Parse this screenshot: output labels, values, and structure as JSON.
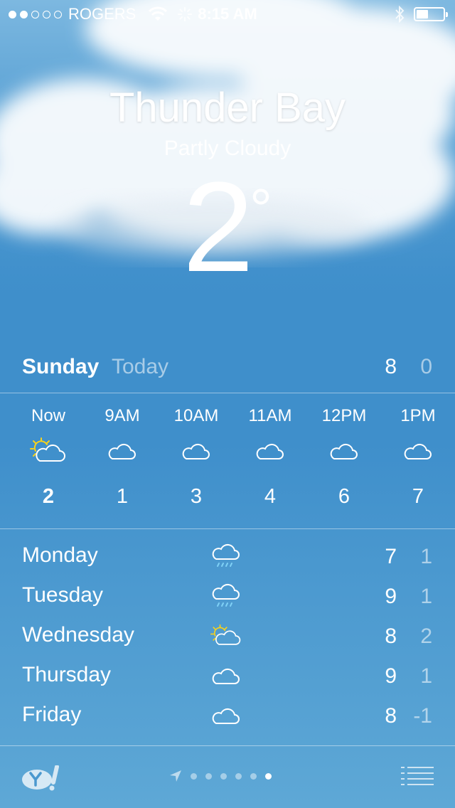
{
  "status_bar": {
    "carrier": "ROGERS",
    "time": "8:15 AM",
    "signal_bars": 2,
    "battery_level": 0.4
  },
  "location": {
    "city": "Thunder Bay",
    "condition": "Partly Cloudy",
    "temperature": "2",
    "degree_symbol": "°"
  },
  "today": {
    "day": "Sunday",
    "label": "Today",
    "high": "8",
    "low": "0"
  },
  "hourly": [
    {
      "time": "Now",
      "icon": "partly-sunny-icon",
      "temp": "2"
    },
    {
      "time": "9AM",
      "icon": "cloud-icon",
      "temp": "1"
    },
    {
      "time": "10AM",
      "icon": "cloud-icon",
      "temp": "3"
    },
    {
      "time": "11AM",
      "icon": "cloud-icon",
      "temp": "4"
    },
    {
      "time": "12PM",
      "icon": "cloud-icon",
      "temp": "6"
    },
    {
      "time": "1PM",
      "icon": "cloud-icon",
      "temp": "7"
    }
  ],
  "daily": [
    {
      "day": "Monday",
      "icon": "rain-cloud-icon",
      "high": "7",
      "low": "1"
    },
    {
      "day": "Tuesday",
      "icon": "rain-cloud-icon",
      "high": "9",
      "low": "1"
    },
    {
      "day": "Wednesday",
      "icon": "partly-sunny-icon",
      "high": "8",
      "low": "2"
    },
    {
      "day": "Thursday",
      "icon": "cloud-icon",
      "high": "9",
      "low": "1"
    },
    {
      "day": "Friday",
      "icon": "cloud-icon",
      "high": "8",
      "low": "-1"
    }
  ],
  "footer": {
    "page_count": 6,
    "active_page": 6
  },
  "colors": {
    "sun": "#f7d21c",
    "rain": "#7fd0f5",
    "sky": "#3f8fcb"
  }
}
